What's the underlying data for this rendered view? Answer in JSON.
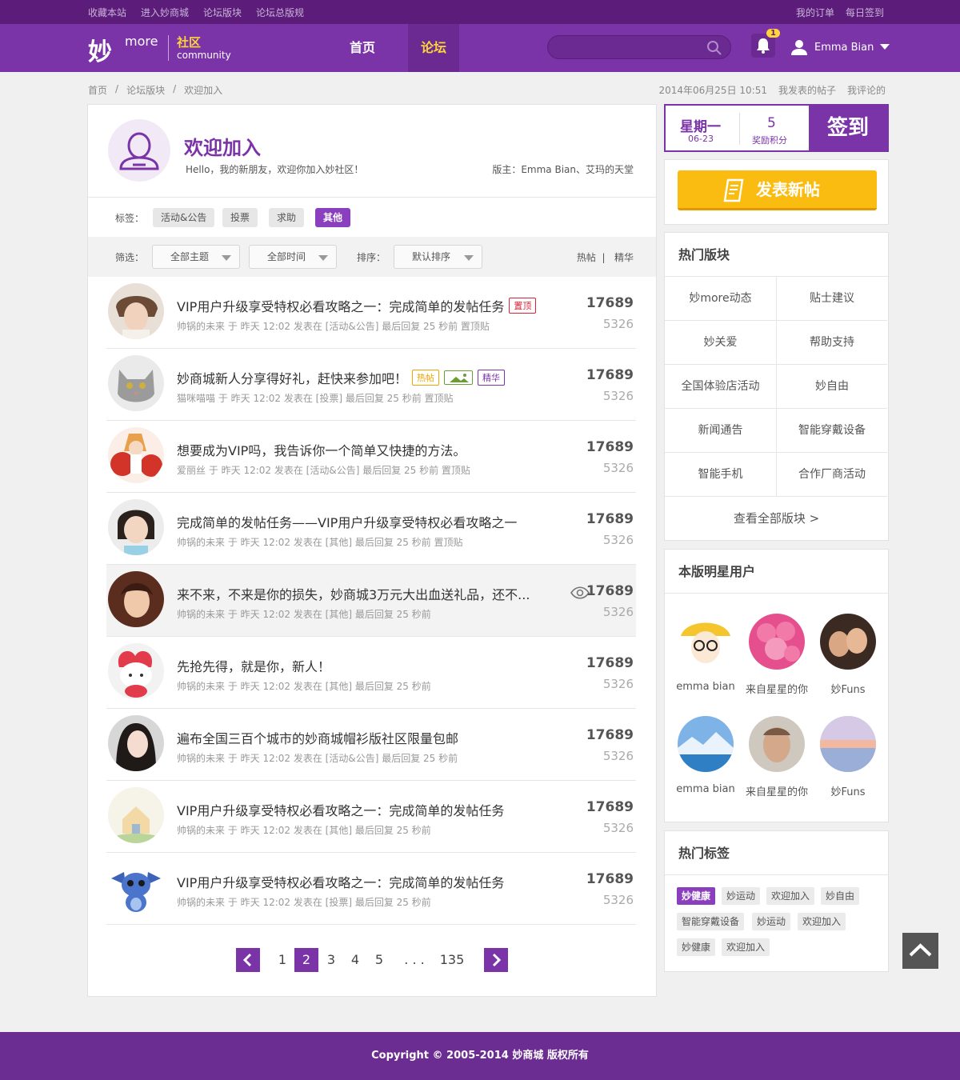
{
  "topbar": {
    "left": [
      "收藏本站",
      "进入妙商城",
      "论坛版块",
      "论坛总版规"
    ],
    "right": [
      "我的订单",
      "每日签到"
    ]
  },
  "header": {
    "logo_mark": "妙",
    "logo_more": "more",
    "logo_sq": "社区",
    "logo_cm": "community",
    "nav_home": "首页",
    "nav_forum": "论坛",
    "search_placeholder": "",
    "notify_count": "1",
    "user_name": "Emma Bian"
  },
  "breadcrumb": [
    "首页",
    "/",
    "论坛版块",
    "/",
    "欢迎加入"
  ],
  "crumb_right": {
    "date": "2014年06月25日 10:51",
    "my_posts": "我发表的帖子",
    "my_comments": "我评论的"
  },
  "forum": {
    "title": "欢迎加入",
    "subtitle": "Hello，我的新朋友，欢迎你加入妙社区！",
    "moderators": "版主：Emma Bian、艾玛的天堂"
  },
  "tags_bar": {
    "label": "标签：",
    "items": [
      "活动&公告",
      "投票",
      "求助",
      "其他"
    ]
  },
  "filter": {
    "label1": "筛选：",
    "topic": "全部主题",
    "time": "全部时间",
    "label2": "排序：",
    "sort": "默认排序",
    "hot": "热帖",
    "sep": "|",
    "best": "精华"
  },
  "posts": [
    {
      "title": "VIP用户升级享受特权必看攻略之一：完成简单的发帖任务",
      "meta": "帅锅的未来  于 昨天 12:02 发表在 [活动&公告] 最后回复 25 秒前 置顶贴",
      "views": "17689",
      "replies": "5326",
      "badge": "置顶"
    },
    {
      "title": " 妙商城新人分享得好礼，赶快来参加吧！",
      "meta": "猫咪喵喵  于 昨天 12:02 发表在 [投票] 最后回复 25 秒前 置顶贴",
      "views": "17689",
      "replies": "5326",
      "badge1": "热帖",
      "badge3": "精华"
    },
    {
      "title": "想要成为VIP吗，我告诉你一个简单又快捷的方法。",
      "meta": "爱丽丝  于 昨天 12:02 发表在 [活动&公告] 最后回复 25 秒前 置顶贴",
      "views": "17689",
      "replies": "5326"
    },
    {
      "title": "完成简单的发帖任务——VIP用户升级享受特权必看攻略之一",
      "meta": "帅锅的未来  于 昨天 12:02 发表在 [其他] 最后回复 25 秒前 置顶贴",
      "views": "17689",
      "replies": "5326"
    },
    {
      "title": "来不来，不来是你的损失，妙商城3万元大出血送礼品，还不...",
      "meta": "帅锅的未来  于 昨天 12:02 发表在 [其他] 最后回复 25 秒前",
      "views": "17689",
      "replies": "5326"
    },
    {
      "title": "先抢先得，就是你，新人！",
      "meta": "帅锅的未来  于 昨天 12:02 发表在 [其他] 最后回复 25 秒前",
      "views": "17689",
      "replies": "5326"
    },
    {
      "title": "遍布全国三百个城市的妙商城帽衫版社区限量包邮",
      "meta": "帅锅的未来  于 昨天 12:02 发表在 [活动&公告] 最后回复 25 秒前",
      "views": "17689",
      "replies": "5326"
    },
    {
      "title": "VIP用户升级享受特权必看攻略之一：完成简单的发帖任务",
      "meta": "帅锅的未来  于 昨天 12:02 发表在 [其他] 最后回复 25 秒前",
      "views": "17689",
      "replies": "5326"
    },
    {
      "title": "VIP用户升级享受特权必看攻略之一：完成简单的发帖任务",
      "meta": "帅锅的未来  于 昨天 12:02 发表在 [投票] 最后回复 25 秒前",
      "views": "17689",
      "replies": "5326"
    }
  ],
  "pagination": {
    "pages": [
      "1",
      "2",
      "3",
      "4",
      "5",
      ". . .",
      "135"
    ],
    "current": "2"
  },
  "checkin": {
    "weekday": "星期一",
    "date": "06-23",
    "points": "5",
    "points_label": "奖励积分",
    "button": "签到"
  },
  "new_post_button": "发表新帖",
  "hot_boards": {
    "title": "热门版块",
    "items": [
      "妙more动态",
      "贴士建议",
      "妙关爱",
      "帮助支持",
      "全国体验店活动",
      "妙自由",
      "新闻通告",
      "智能穿戴设备",
      "智能手机",
      "合作厂商活动"
    ],
    "view_all": "查看全部版块 >"
  },
  "star_users": {
    "title": "本版明星用户",
    "users": [
      "emma bian",
      "来自星星的你",
      "妙Funs",
      "emma bian",
      "来自星星的你",
      "妙Funs"
    ]
  },
  "hot_tags": {
    "title": "热门标签",
    "items": [
      "妙健康",
      "妙运动",
      "欢迎加入",
      "妙自由",
      "智能穿戴设备",
      "妙运动",
      "欢迎加入",
      "妙健康",
      "欢迎加入"
    ]
  },
  "footer": "Copyright © 2005-2014 妙商城 版权所有",
  "colors": {
    "brand": "#7b34a8",
    "accent": "#ffd43b",
    "button": "#fbbc12"
  }
}
